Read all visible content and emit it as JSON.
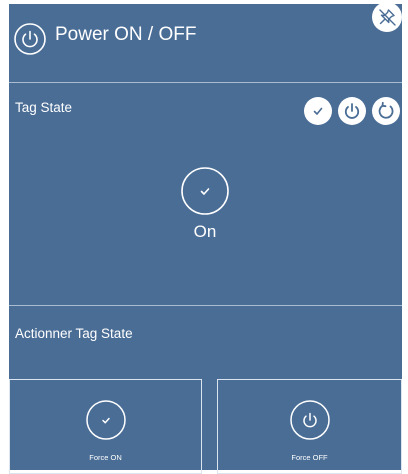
{
  "header": {
    "title": "Power ON / OFF",
    "icon": "power-icon",
    "pin_icon": "pin-off-icon"
  },
  "tag_state": {
    "label": "Tag State",
    "value": "On",
    "buttons": [
      "check-icon",
      "power-icon",
      "refresh-icon"
    ]
  },
  "actions": {
    "label": "Actionner Tag State",
    "items": [
      {
        "label": "Force ON",
        "icon": "check-icon"
      },
      {
        "label": "Force OFF",
        "icon": "power-icon"
      }
    ]
  },
  "colors": {
    "panel_bg": "#4a6d96",
    "divider": "#a9bcd2",
    "foreground": "#ffffff"
  }
}
